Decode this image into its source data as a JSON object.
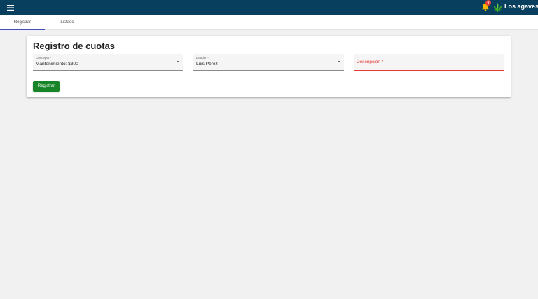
{
  "topbar": {
    "menu_icon": "menu-icon",
    "notification_icon": "bell-icon",
    "notification_count": "0",
    "brand_icon": "leaf-logo-icon",
    "brand_name": "Los agaves",
    "bg_color": "#093f5e",
    "bell_color": "#f5b800",
    "badge_color": "#e53935"
  },
  "tabs": [
    {
      "label": "Registrar",
      "active": true
    },
    {
      "label": "Listado",
      "active": false
    }
  ],
  "form": {
    "title": "Registro de cuotas",
    "concepto": {
      "label": "Concepto *",
      "value": "Mantenimiento: $300"
    },
    "deudor": {
      "label": "Deudor *",
      "value": "Luis Pérez"
    },
    "descripcion": {
      "placeholder": "Descripción *",
      "value": ""
    },
    "submit_label": "Registrar",
    "submit_color": "#188428",
    "error_color": "#e53935"
  }
}
